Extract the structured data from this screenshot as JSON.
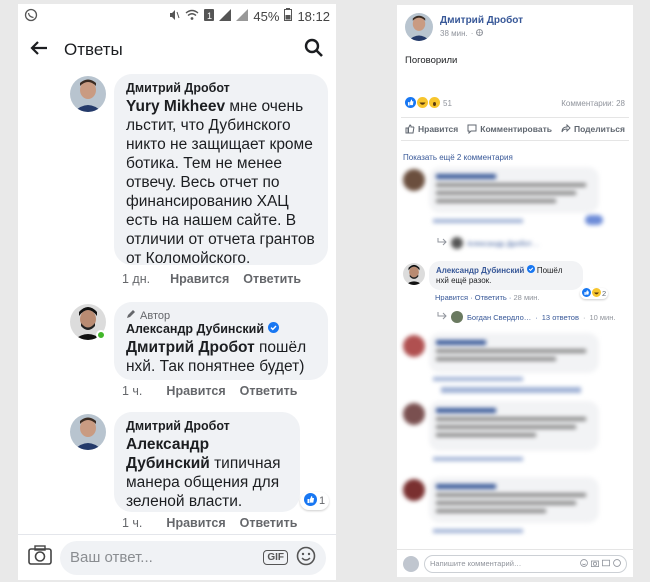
{
  "statusbar": {
    "battery": "45%",
    "time": "18:12"
  },
  "appbar": {
    "title": "Ответы"
  },
  "comments": [
    {
      "author": "Дмитрий Дробот",
      "mention": "Yury Mikheev",
      "text": " мне очень льстит, что Дубинского никто не защищает кроме ботика. Тем не менее отвечу. Весь отчет по финансированию ХАЦ есть на нашем сайте. В отличии от отчета грантов от Коломойского.",
      "time": "1 дн.",
      "like": "Нравится",
      "reply": "Ответить"
    },
    {
      "badge": "Автор",
      "author": "Александр Дубинский",
      "mention": "Дмитрий Дробот",
      "text": " пошёл нхй. Так понятнее будет)",
      "time": "1 ч.",
      "like": "Нравится",
      "reply": "Ответить"
    },
    {
      "author": "Дмитрий Дробот",
      "mention": "Александр Дубинский",
      "text": " типичная манера общения для зеленой власти.",
      "reactions": "1",
      "time": "1 ч.",
      "like": "Нравится",
      "reply": "Ответить"
    }
  ],
  "composer": {
    "placeholder": "Ваш ответ...",
    "gif": "GIF"
  },
  "fb": {
    "author": "Дмитрий Дробот",
    "time": "38 мин.",
    "post_text": "Поговорили",
    "reaction_count": "51",
    "comments_count": "Комментарии: 28",
    "like": "Нравится",
    "comment": "Комментировать",
    "share": "Поделиться",
    "show_more": "Показать ещё 2 комментария",
    "reply_snippet_1": "Александр Дробот…",
    "highlight": {
      "author": "Александр Дубинский",
      "text": "Пошёл нхй ещё разок.",
      "like": "Нравится",
      "reply": "Ответить",
      "time": "28 мин.",
      "reactions": "2"
    },
    "replies_name": "Богдан Свердло…",
    "replies_count": "13 ответов",
    "replies_time": "10 мин.",
    "composer_placeholder": "Напишите комментарий…"
  }
}
